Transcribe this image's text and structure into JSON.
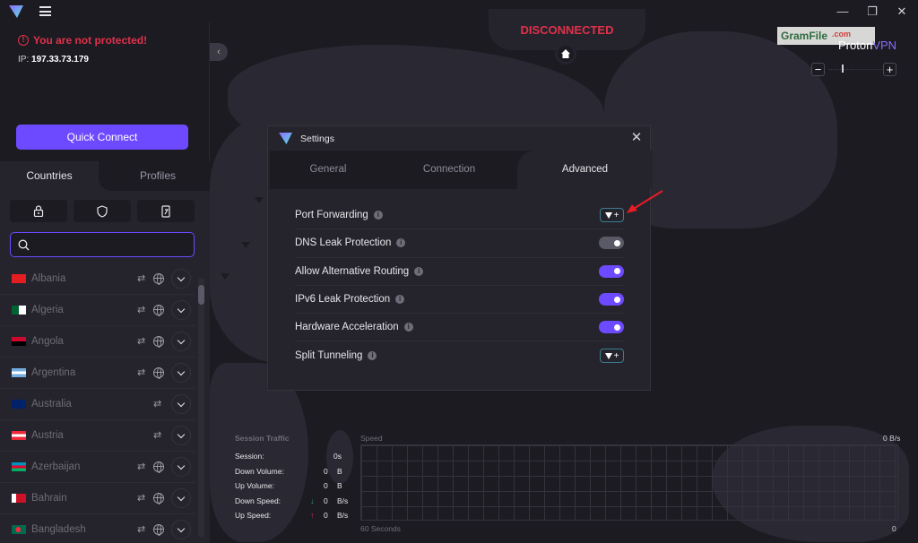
{
  "window": {
    "controls": {
      "minimize": "—",
      "restore": "❐",
      "close": "✕"
    }
  },
  "sidebar": {
    "status_text": "You are not protected!",
    "ip_label": "IP:",
    "ip_value": "197.33.73.179",
    "quick_connect_label": "Quick Connect",
    "tabs": [
      {
        "label": "Countries",
        "active": true
      },
      {
        "label": "Profiles",
        "active": false
      }
    ],
    "filters": [
      {
        "name": "secure-core",
        "icon": "lock-icon"
      },
      {
        "name": "netshield",
        "icon": "shield-icon"
      },
      {
        "name": "streaming",
        "icon": "phone-icon"
      }
    ],
    "search": {
      "value": "",
      "placeholder": ""
    },
    "countries": [
      {
        "name": "Albania",
        "p2p": true,
        "tor": true
      },
      {
        "name": "Algeria",
        "p2p": true,
        "tor": true
      },
      {
        "name": "Angola",
        "p2p": true,
        "tor": true
      },
      {
        "name": "Argentina",
        "p2p": true,
        "tor": true
      },
      {
        "name": "Australia",
        "p2p": true,
        "tor": false
      },
      {
        "name": "Austria",
        "p2p": true,
        "tor": false
      },
      {
        "name": "Azerbaijan",
        "p2p": true,
        "tor": true
      },
      {
        "name": "Bahrain",
        "p2p": true,
        "tor": true
      },
      {
        "name": "Bangladesh",
        "p2p": true,
        "tor": true
      }
    ]
  },
  "map": {
    "connection_status": "DISCONNECTED",
    "watermark_text": "GramFile",
    "watermark_suffix": ".com",
    "brand_proton": "Proton",
    "brand_vpn": "VPN",
    "zoom_out": "−",
    "zoom_in": "+"
  },
  "settings_dialog": {
    "title": "Settings",
    "close": "✕",
    "tabs": [
      {
        "label": "General",
        "active": false
      },
      {
        "label": "Connection",
        "active": false
      },
      {
        "label": "Advanced",
        "active": true
      }
    ],
    "options": [
      {
        "label": "Port Forwarding",
        "control": "upsell"
      },
      {
        "label": "DNS Leak Protection",
        "control": "toggle",
        "on": false
      },
      {
        "label": "Allow Alternative Routing",
        "control": "toggle",
        "on": true
      },
      {
        "label": "IPv6 Leak Protection",
        "control": "toggle",
        "on": true
      },
      {
        "label": "Hardware Acceleration",
        "control": "toggle",
        "on": true
      },
      {
        "label": "Split Tunneling",
        "control": "upsell"
      }
    ],
    "upsell_plus": "+",
    "info_glyph": "i"
  },
  "traffic": {
    "title": "Session Traffic",
    "rows": [
      {
        "label": "Session:",
        "value": "0s",
        "unit": "",
        "arrow": ""
      },
      {
        "label": "Down Volume:",
        "value": "0",
        "unit": "B",
        "arrow": ""
      },
      {
        "label": "Up Volume:",
        "value": "0",
        "unit": "B",
        "arrow": ""
      },
      {
        "label": "Down Speed:",
        "value": "0",
        "unit": "B/s",
        "arrow": "↓"
      },
      {
        "label": "Up Speed:",
        "value": "0",
        "unit": "B/s",
        "arrow": "↑"
      }
    ],
    "speed_label": "Speed",
    "speed_max": "0  B/s",
    "x_label": "60 Seconds",
    "x_end": "0"
  },
  "colors": {
    "accent": "#6d4aff",
    "danger": "#e0314b",
    "toggle_off": "#5a5966",
    "down_arrow": "#2e9e6e",
    "up_arrow": "#c8324a"
  }
}
